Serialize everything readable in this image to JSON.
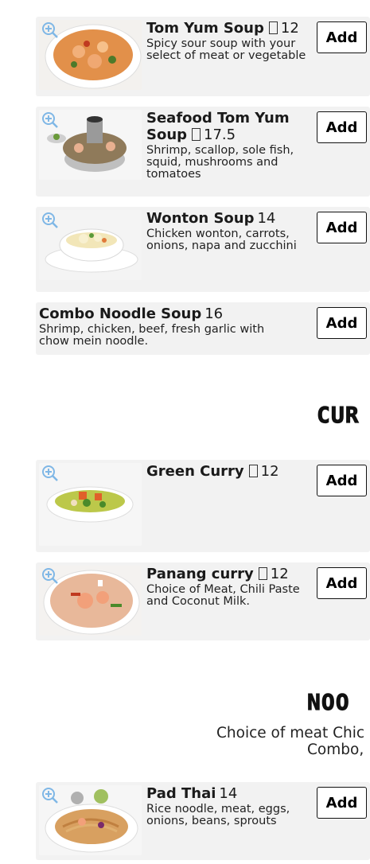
{
  "soups": [
    {
      "name": "Tom Yum Soup",
      "spicy": true,
      "price": "12",
      "desc": "Spicy sour soup with your select of meat or vegetable",
      "image": "tom-yum-soup-photo"
    },
    {
      "name": "Seafood Tom Yum Soup",
      "spicy": true,
      "price": "17.5",
      "desc": "Shrimp, scallop, sole fish, squid, mushrooms and tomatoes",
      "image": "seafood-tom-yum-photo"
    },
    {
      "name": "Wonton Soup",
      "spicy": false,
      "price": "14",
      "desc": "Chicken wonton, carrots, onions, napa and zucchini",
      "image": "wonton-soup-photo"
    },
    {
      "name": "Combo Noodle Soup",
      "spicy": false,
      "price": "16",
      "desc": "Shrimp, chicken, beef, fresh garlic with chow mein noodle."
    }
  ],
  "curry_section": {
    "title": "CUR"
  },
  "curries": [
    {
      "name": "Green Curry",
      "spicy": true,
      "price": "12",
      "desc": "",
      "image": "green-curry-photo"
    },
    {
      "name": "Panang curry",
      "spicy": true,
      "price": "12",
      "desc": "Choice of Meat, Chili Paste and Coconut Milk.",
      "image": "panang-curry-photo"
    }
  ],
  "noodle_section": {
    "title": "NOO",
    "subtitle_line1": "Choice of meat Chic",
    "subtitle_line2": "Combo,"
  },
  "noodles": [
    {
      "name": "Pad Thai",
      "spicy": false,
      "price": "14",
      "desc": "Rice noodle, meat, eggs, onions, beans, sprouts",
      "image": "pad-thai-photo"
    }
  ],
  "ui": {
    "add_label": "Add",
    "chili_glyph": "▯",
    "zoom_icon": "zoom-in-icon",
    "accent": "#7fb7e6"
  }
}
